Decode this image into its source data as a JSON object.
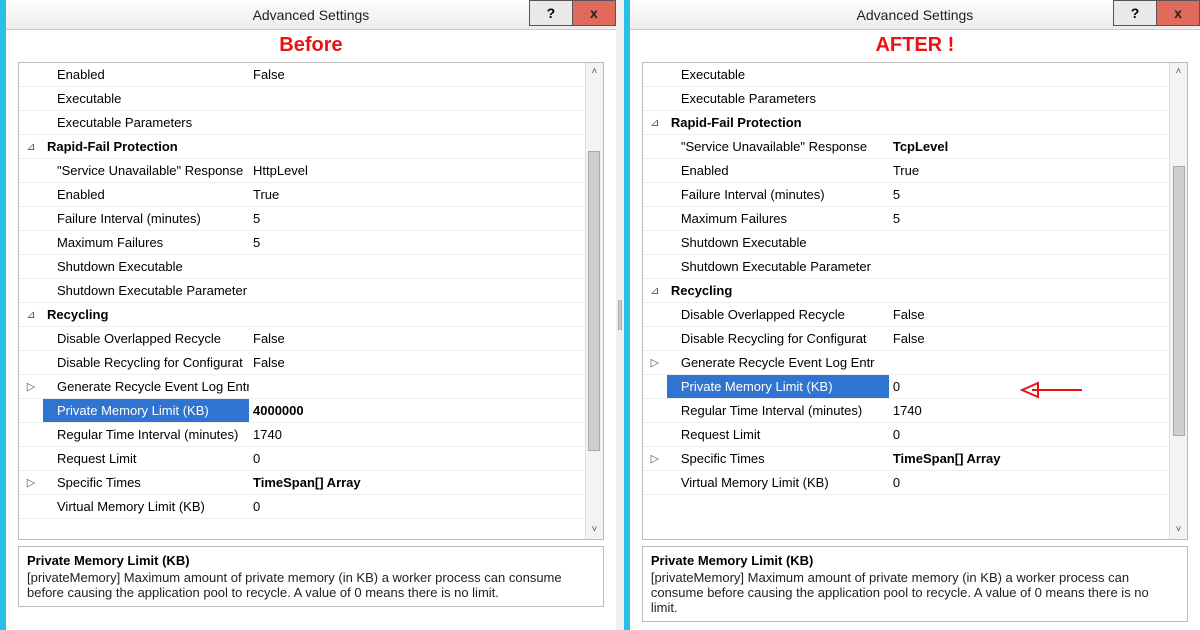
{
  "left": {
    "title": "Advanced Settings",
    "annot": "Before",
    "labelWidth": 230,
    "thumbHeight": 300,
    "rows": [
      {
        "g": "",
        "label": "Enabled",
        "val": "False",
        "indent": 1
      },
      {
        "g": "",
        "label": "Executable",
        "val": "",
        "indent": 1
      },
      {
        "g": "",
        "label": "Executable Parameters",
        "val": "",
        "indent": 1
      },
      {
        "g": "⊿",
        "label": "Rapid-Fail Protection",
        "val": "",
        "cat": true,
        "indent": 0
      },
      {
        "g": "",
        "label": "\"Service Unavailable\" Response ",
        "val": "HttpLevel",
        "indent": 1
      },
      {
        "g": "",
        "label": "Enabled",
        "val": "True",
        "indent": 1
      },
      {
        "g": "",
        "label": "Failure Interval (minutes)",
        "val": "5",
        "indent": 1
      },
      {
        "g": "",
        "label": "Maximum Failures",
        "val": "5",
        "indent": 1
      },
      {
        "g": "",
        "label": "Shutdown Executable",
        "val": "",
        "indent": 1
      },
      {
        "g": "",
        "label": "Shutdown Executable Parameter",
        "val": "",
        "indent": 1
      },
      {
        "g": "⊿",
        "label": "Recycling",
        "val": "",
        "cat": true,
        "indent": 0
      },
      {
        "g": "",
        "label": "Disable Overlapped Recycle",
        "val": "False",
        "indent": 1
      },
      {
        "g": "",
        "label": "Disable Recycling for Configurat",
        "val": "False",
        "indent": 1
      },
      {
        "g": "▷",
        "label": "Generate Recycle Event Log Entr",
        "val": "",
        "indent": 1
      },
      {
        "g": "",
        "label": "Private Memory Limit (KB)",
        "val": "4000000",
        "indent": 1,
        "sel": true,
        "boldVal": true
      },
      {
        "g": "",
        "label": "Regular Time Interval (minutes)",
        "val": "1740",
        "indent": 1
      },
      {
        "g": "",
        "label": "Request Limit",
        "val": "0",
        "indent": 1
      },
      {
        "g": "▷",
        "label": "Specific Times",
        "val": "TimeSpan[] Array",
        "indent": 1,
        "boldVal": true
      },
      {
        "g": "",
        "label": "Virtual Memory Limit (KB)",
        "val": "0",
        "indent": 1
      }
    ],
    "desc": {
      "title": "Private Memory Limit (KB)",
      "body": "[privateMemory] Maximum amount of private memory (in KB) a worker process can consume before causing the application pool to recycle.  A value of 0 means there is no limit."
    }
  },
  "right": {
    "title": "Advanced Settings",
    "annot": "AFTER !",
    "labelWidth": 246,
    "thumbHeight": 270,
    "rows": [
      {
        "g": "",
        "label": "Executable",
        "val": "",
        "indent": 1
      },
      {
        "g": "",
        "label": "Executable Parameters",
        "val": "",
        "indent": 1
      },
      {
        "g": "⊿",
        "label": "Rapid-Fail Protection",
        "val": "",
        "cat": true,
        "indent": 0
      },
      {
        "g": "",
        "label": "\"Service Unavailable\" Response ",
        "val": "TcpLevel",
        "indent": 1,
        "boldVal": true
      },
      {
        "g": "",
        "label": "Enabled",
        "val": "True",
        "indent": 1
      },
      {
        "g": "",
        "label": "Failure Interval (minutes)",
        "val": "5",
        "indent": 1
      },
      {
        "g": "",
        "label": "Maximum Failures",
        "val": "5",
        "indent": 1
      },
      {
        "g": "",
        "label": "Shutdown Executable",
        "val": "",
        "indent": 1
      },
      {
        "g": "",
        "label": "Shutdown Executable Parameter",
        "val": "",
        "indent": 1
      },
      {
        "g": "⊿",
        "label": "Recycling",
        "val": "",
        "cat": true,
        "indent": 0
      },
      {
        "g": "",
        "label": "Disable Overlapped Recycle",
        "val": "False",
        "indent": 1
      },
      {
        "g": "",
        "label": "Disable Recycling for Configurat",
        "val": "False",
        "indent": 1
      },
      {
        "g": "▷",
        "label": "Generate Recycle Event Log Entr",
        "val": "",
        "indent": 1
      },
      {
        "g": "",
        "label": "Private Memory Limit (KB)",
        "val": "0",
        "indent": 1,
        "sel": true
      },
      {
        "g": "",
        "label": "Regular Time Interval (minutes)",
        "val": "1740",
        "indent": 1
      },
      {
        "g": "",
        "label": "Request Limit",
        "val": "0",
        "indent": 1
      },
      {
        "g": "▷",
        "label": "Specific Times",
        "val": "TimeSpan[] Array",
        "indent": 1,
        "boldVal": true
      },
      {
        "g": "",
        "label": "Virtual Memory Limit (KB)",
        "val": "0",
        "indent": 1
      }
    ],
    "desc": {
      "title": "Private Memory Limit (KB)",
      "body": "[privateMemory] Maximum amount of private memory (in KB) a worker process can consume before causing the application pool to recycle.  A value of 0 means there is no limit."
    }
  },
  "help_label": "?",
  "close_label": "x"
}
